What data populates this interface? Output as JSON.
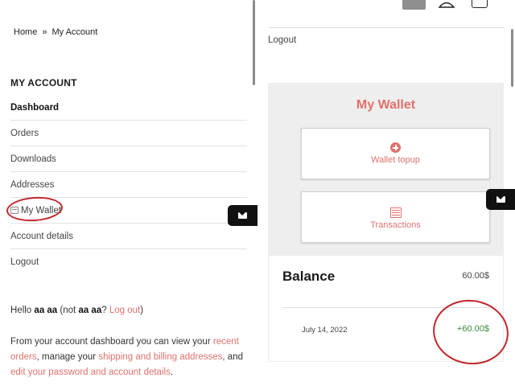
{
  "breadcrumb": {
    "home": "Home",
    "separator": "»",
    "current": "My Account"
  },
  "account": {
    "title": "MY ACCOUNT",
    "nav": [
      {
        "label": "Dashboard",
        "active": true
      },
      {
        "label": "Orders"
      },
      {
        "label": "Downloads"
      },
      {
        "label": "Addresses"
      },
      {
        "label": "My Wallet"
      },
      {
        "label": "Account details"
      },
      {
        "label": "Logout"
      }
    ]
  },
  "greeting": {
    "hello": "Hello",
    "user": "aa aa",
    "not_prefix": "(not",
    "user2": "aa aa",
    "q": "?",
    "logout_link": "Log out",
    "close": ")"
  },
  "dashboard_text": {
    "p1": "From your account dashboard you can view your",
    "link1": "recent orders",
    "p2": ", manage your",
    "link2": "shipping and billing addresses",
    "p3": ", and",
    "link3": "edit your password and account details",
    "p4": "."
  },
  "right": {
    "logout": "Logout",
    "wallet_title": "My Wallet",
    "topup_label": "Wallet topup",
    "transactions_label": "Transactions",
    "balance_label": "Balance",
    "balance_value": "60.00$",
    "transaction": {
      "date": "July 14, 2022",
      "amount": "+60.00$"
    }
  },
  "colors": {
    "accent": "#e0716c",
    "annotation": "#c0282d",
    "positive": "#3a8a3a",
    "panel": "#eeeeee"
  },
  "icons": [
    "wallet-icon",
    "envelope-icon",
    "plus-circle-icon",
    "list-icon",
    "user-icon",
    "cart-icon"
  ]
}
